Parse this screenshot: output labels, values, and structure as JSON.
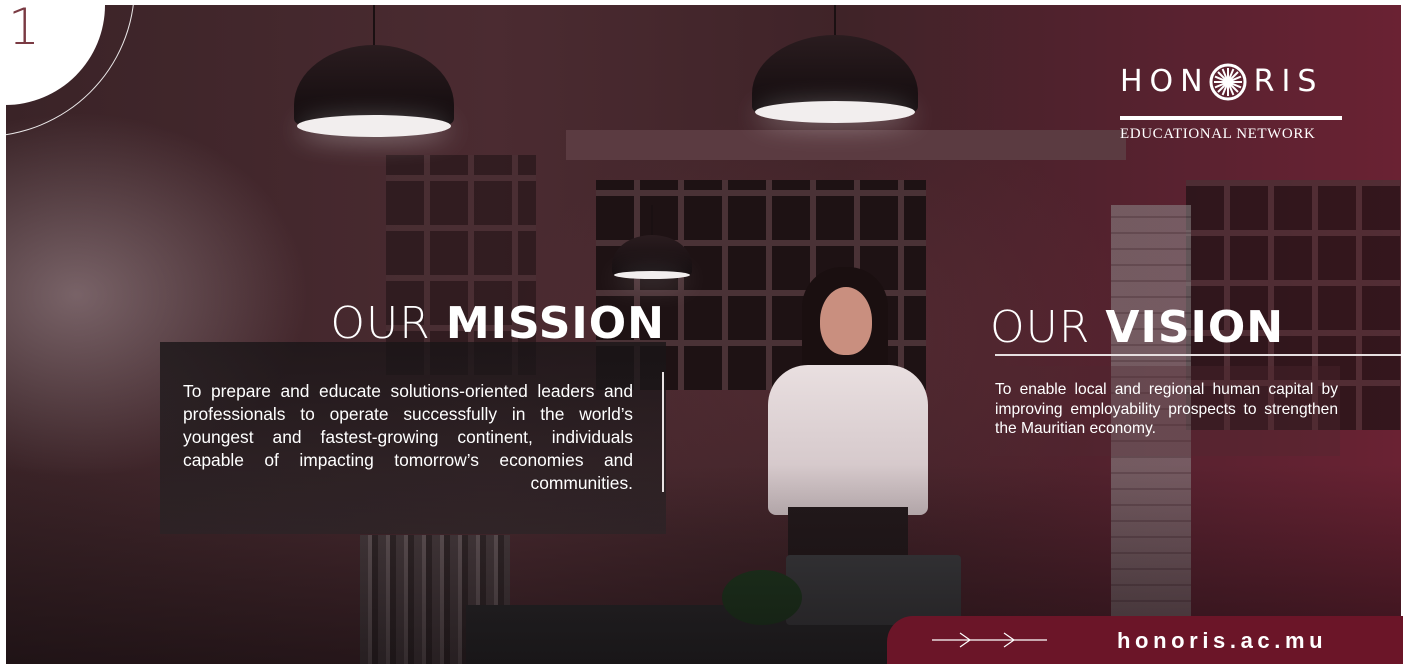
{
  "page": {
    "number": "1"
  },
  "brand": {
    "logo_word_left": "HON",
    "logo_word_right": "RIS",
    "logo_subtitle": "EDUCATIONAL NETWORK",
    "logo_icon": "sunburst-o-icon"
  },
  "mission": {
    "heading_light": "OUR ",
    "heading_bold": "MISSION",
    "body": "To prepare and educate solutions-oriented leaders and professionals to operate successfully in the world’s youngest and fastest-growing continent, individuals capable of impacting tomorrow’s economies and communities."
  },
  "vision": {
    "heading_light": "OUR ",
    "heading_bold": "VISION",
    "body": "To enable local and regional human capital by improving employability prospects to strengthen the Mauritian economy."
  },
  "footer": {
    "url": "honoris.ac.mu",
    "arrow_icon": "long-arrow-right-icon"
  },
  "colors": {
    "brand_maroon": "#6b1528",
    "page_number": "#7a3a43",
    "text": "#ffffff"
  }
}
